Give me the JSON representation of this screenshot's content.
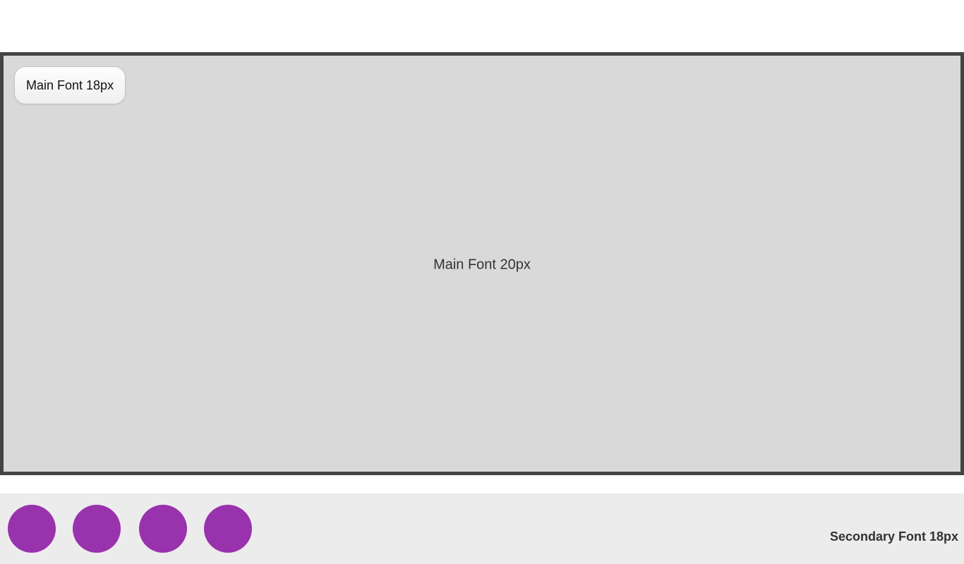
{
  "stage": {
    "corner_button_label": "Main Font 18px",
    "center_text": "Main Font 20px"
  },
  "bottom_bar": {
    "secondary_text": "Secondary Font 18px",
    "dots": [
      "",
      "",
      "",
      ""
    ]
  },
  "colors": {
    "dot": "#9932ad",
    "stage_background": "#d9d9d9",
    "stage_border": "#444444",
    "bottom_bar_background": "#ececec"
  }
}
